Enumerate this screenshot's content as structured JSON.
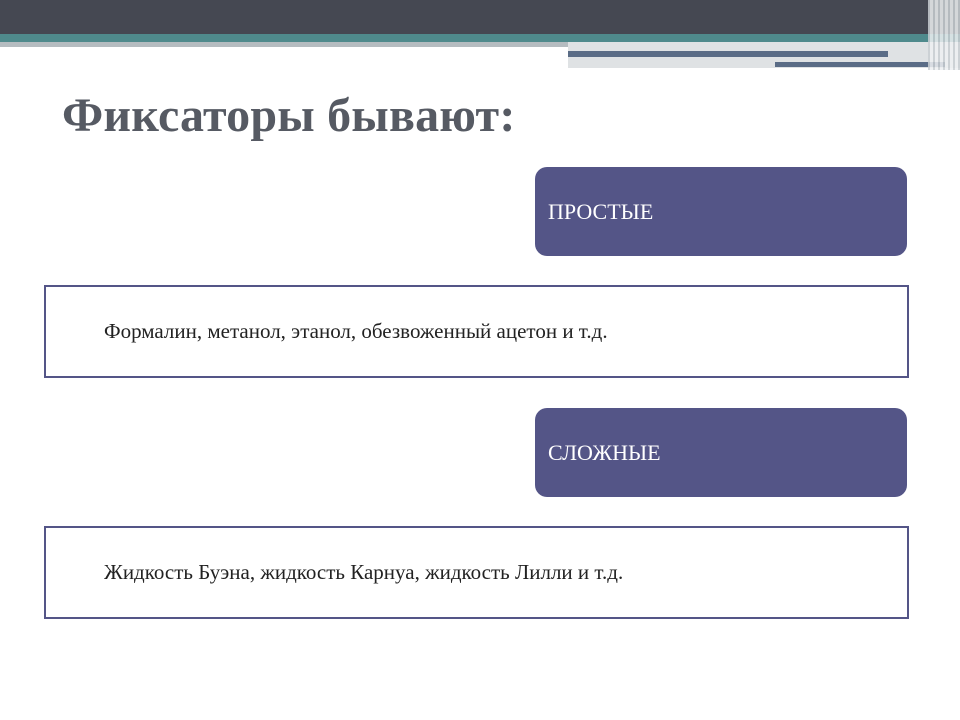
{
  "slide": {
    "title": "Фиксаторы бывают:",
    "categories": [
      {
        "label": "ПРОСТЫЕ",
        "examples": "Формалин, метанол, этанол, обезвоженный ацетон и т.д."
      },
      {
        "label": "СЛОЖНЫЕ",
        "examples": "Жидкость Буэна, жидкость Карнуа, жидкость Лилли и т.д."
      }
    ]
  },
  "colors": {
    "accent": "#545587",
    "title_text": "#565a63",
    "header_dark": "#454852",
    "header_teal": "#4f8a8c"
  }
}
